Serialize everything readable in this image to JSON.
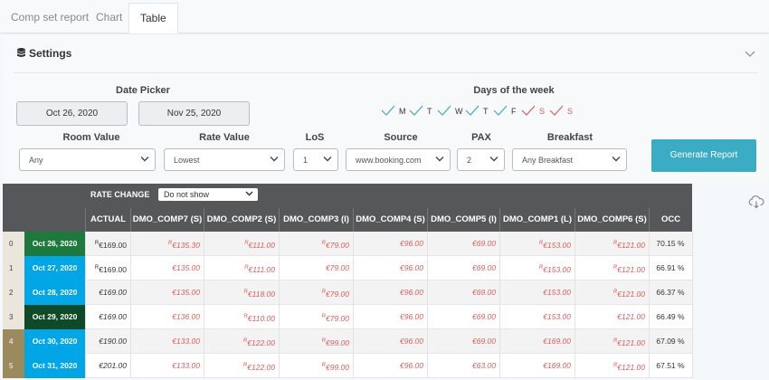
{
  "tabs": [
    {
      "label": "Comp set report",
      "active": false
    },
    {
      "label": "Chart",
      "active": false
    },
    {
      "label": "Table",
      "active": true
    }
  ],
  "settings": {
    "title": "Settings",
    "date_picker_label": "Date Picker",
    "date_from": "Oct 26, 2020",
    "date_to": "Nov 25, 2020",
    "days_label": "Days of the week",
    "days": [
      {
        "letter": "M",
        "color": "#3aacc4",
        "text_color": "#333333"
      },
      {
        "letter": "T",
        "color": "#3aacc4",
        "text_color": "#333333"
      },
      {
        "letter": "W",
        "color": "#3aacc4",
        "text_color": "#333333"
      },
      {
        "letter": "T",
        "color": "#3aacc4",
        "text_color": "#333333"
      },
      {
        "letter": "F",
        "color": "#3aacc4",
        "text_color": "#333333"
      },
      {
        "letter": "S",
        "color": "#e05b5b",
        "text_color": "#e05b5b"
      },
      {
        "letter": "S",
        "color": "#e05b5b",
        "text_color": "#e05b5b"
      }
    ],
    "room_value_label": "Room Value",
    "room_value": "Any",
    "rate_value_label": "Rate Value",
    "rate_value": "Lowest",
    "los_label": "LoS",
    "los_value": "1",
    "source_label": "Source",
    "source_value": "www.booking.com",
    "pax_label": "PAX",
    "pax_value": "2",
    "breakfast_label": "Breakfast",
    "breakfast_value": "Any Breakfast",
    "generate_label": "Generate Report"
  },
  "table": {
    "rate_change_label": "RATE CHANGE",
    "rate_change_value": "Do not show",
    "columns": [
      "ACTUAL",
      "DMO_COMP7 (S)",
      "DMO_COMP2 (S)",
      "DMO_COMP3 (I)",
      "DMO_COMP4 (S)",
      "DMO_COMP5 (I)",
      "DMO_COMP1 (L)",
      "DMO_COMP6 (S)",
      "OCC"
    ],
    "rows": [
      {
        "index": "0",
        "date": "Oct 26, 2020",
        "date_bg": "#1e7a3c",
        "index_bg": "#ebe6dc",
        "cells": [
          {
            "sup": "R",
            "value": "€169.00"
          },
          {
            "sup": "R",
            "value": "€135.30"
          },
          {
            "sup": "R",
            "value": "€111.00"
          },
          {
            "sup": "R",
            "value": "€79.00"
          },
          {
            "sup": "",
            "value": "€96.00"
          },
          {
            "sup": "",
            "value": "€69.00"
          },
          {
            "sup": "R",
            "value": "€153.00"
          },
          {
            "sup": "R",
            "value": "€121.00"
          }
        ],
        "occ": "70.15 %"
      },
      {
        "index": "1",
        "date": "Oct 27, 2020",
        "date_bg": "#00a6e6",
        "index_bg": "#ebe6dc",
        "cells": [
          {
            "sup": "R",
            "value": "€169.00"
          },
          {
            "sup": "",
            "value": "€135.00"
          },
          {
            "sup": "R",
            "value": "€111.00"
          },
          {
            "sup": "",
            "value": "€79.00"
          },
          {
            "sup": "",
            "value": "€96.00"
          },
          {
            "sup": "",
            "value": "€69.00"
          },
          {
            "sup": "R",
            "value": "€153.00"
          },
          {
            "sup": "R",
            "value": "€121.00"
          }
        ],
        "occ": "66.91 %"
      },
      {
        "index": "2",
        "date": "Oct 28, 2020",
        "date_bg": "#00a6e6",
        "index_bg": "#ebe6dc",
        "cells": [
          {
            "sup": "",
            "value": "€169.00"
          },
          {
            "sup": "",
            "value": "€135.00"
          },
          {
            "sup": "R",
            "value": "€118.00"
          },
          {
            "sup": "R",
            "value": "€79.00"
          },
          {
            "sup": "",
            "value": "€96.00"
          },
          {
            "sup": "",
            "value": "€69.00"
          },
          {
            "sup": "",
            "value": "€153.00"
          },
          {
            "sup": "R",
            "value": "€121.00"
          }
        ],
        "occ": "66.37 %"
      },
      {
        "index": "3",
        "date": "Oct 29, 2020",
        "date_bg": "#0e4a27",
        "index_bg": "#ebe6dc",
        "cells": [
          {
            "sup": "",
            "value": "€169.00"
          },
          {
            "sup": "",
            "value": "€136.00"
          },
          {
            "sup": "R",
            "value": "€110.00"
          },
          {
            "sup": "R",
            "value": "€79.00"
          },
          {
            "sup": "",
            "value": "€96.00"
          },
          {
            "sup": "",
            "value": "€69.00"
          },
          {
            "sup": "",
            "value": "€153.00"
          },
          {
            "sup": "",
            "value": "€121.00"
          }
        ],
        "occ": "66.49 %"
      },
      {
        "index": "4",
        "date": "Oct 30, 2020",
        "date_bg": "#00a6e6",
        "index_bg": "#9b8a5b",
        "cells": [
          {
            "sup": "",
            "value": "€190.00"
          },
          {
            "sup": "",
            "value": "€133.00"
          },
          {
            "sup": "R",
            "value": "€122.00"
          },
          {
            "sup": "R",
            "value": "€99.00"
          },
          {
            "sup": "",
            "value": "€96.00"
          },
          {
            "sup": "",
            "value": "€69.00"
          },
          {
            "sup": "",
            "value": "€169.00"
          },
          {
            "sup": "R",
            "value": "€121.00"
          }
        ],
        "occ": "67.09 %"
      },
      {
        "index": "5",
        "date": "Oct 31, 2020",
        "date_bg": "#00a6e6",
        "index_bg": "#9b8a5b",
        "cells": [
          {
            "sup": "",
            "value": "€201.00"
          },
          {
            "sup": "",
            "value": "€133.00"
          },
          {
            "sup": "R",
            "value": "€122.00"
          },
          {
            "sup": "R",
            "value": "€99.00"
          },
          {
            "sup": "",
            "value": "€96.00"
          },
          {
            "sup": "",
            "value": "€63.00"
          },
          {
            "sup": "",
            "value": "€169.00"
          },
          {
            "sup": "R",
            "value": "€121.00"
          }
        ],
        "occ": "67.51 %"
      }
    ]
  }
}
